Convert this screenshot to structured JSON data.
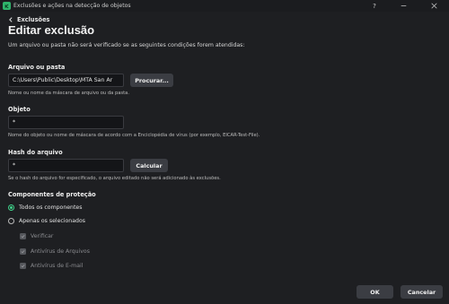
{
  "window": {
    "title": "Exclusões e ações na detecção de objetos",
    "help_icon": "help-icon",
    "minimize_icon": "minimize-icon",
    "close_icon": "close-icon"
  },
  "header": {
    "back_label": "Exclusões",
    "page_title": "Editar exclusão",
    "subtitle": "Um arquivo ou pasta não será verificado se as seguintes condições forem atendidas:"
  },
  "file_or_folder": {
    "label": "Arquivo ou pasta",
    "value": "C:\\Users\\Public\\Desktop\\MTA San Ar",
    "browse_label": "Procurar...",
    "hint": "Nome ou nome da máscara de arquivo ou da pasta."
  },
  "object": {
    "label": "Objeto",
    "value": "*",
    "hint": "Nome do objeto ou nome de máscara de acordo com a Enciclopédia de vírus (por exemplo, EICAR-Test-File)."
  },
  "hash": {
    "label": "Hash do arquivo",
    "value": "*",
    "calculate_label": "Calcular",
    "hint": "Se o hash do arquivo for especificado, o arquivo editado não será adicionado às exclusões."
  },
  "protection": {
    "label": "Componentes de proteção",
    "options": [
      {
        "label": "Todos os componentes",
        "selected": true
      },
      {
        "label": "Apenas os selecionados",
        "selected": false
      }
    ],
    "components": [
      {
        "label": "Verificar",
        "checked": true
      },
      {
        "label": "Antivírus de Arquivos",
        "checked": true
      },
      {
        "label": "Antivírus de E-mail",
        "checked": true
      }
    ]
  },
  "footer": {
    "ok_label": "OK",
    "cancel_label": "Cancelar"
  },
  "colors": {
    "background": "#1e1f22",
    "accent": "#3fd28a",
    "button": "#3b3d43"
  }
}
